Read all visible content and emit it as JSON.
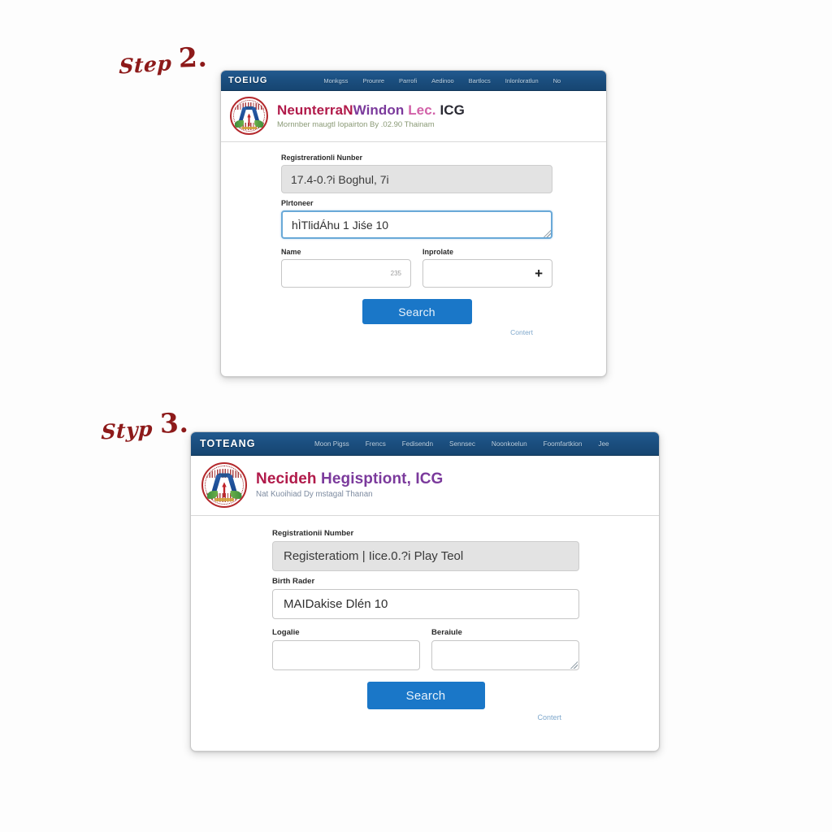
{
  "annotations": {
    "step2": {
      "word": "Step",
      "number": "2."
    },
    "step3": {
      "word": "Styp",
      "number": "3."
    }
  },
  "colors": {
    "navbar": "#1b4f80",
    "search_button": "#1a77c8",
    "readonly_field": "#e3e3e3",
    "focus_border": "#6aa9d8",
    "title_primary": "#b11a4a",
    "title_secondary": "#7b3a9c",
    "helper_link": "#7fa8cc",
    "annotation_ink": "#8d1a1a"
  },
  "window_step2": {
    "navbar": {
      "brand": "TOEIUG",
      "links": [
        "Monkgss",
        "Prounre",
        "Parrofi",
        "Aedinoo",
        "Bartlocs",
        "Inlonloratlun",
        "No"
      ]
    },
    "masthead": {
      "emblem_name": "national-emblem-icon",
      "title_part_1": "NeunterraN",
      "title_part_2": "Windon ",
      "title_part_3": "Lec. ",
      "title_part_4": "ICG",
      "subtitle": "Mornnber maugtl Iopairton By .02.90 Thainam"
    },
    "form": {
      "registration_label": "Registrerationli Nunber",
      "registration_value": "17.4-0.?i Boghul, 7i",
      "pioneer_label": "Plrtoneer",
      "pioneer_value": "hÌTlidÁhu 1 Jiśe 10",
      "name_label": "Name",
      "name_value": "",
      "name_counter": "235",
      "inprolate_label": "Inprolate",
      "inprolate_value": "",
      "inprolate_glyph": "+",
      "search_label": "Search",
      "helper_link_label": "Contert"
    }
  },
  "window_step3": {
    "navbar": {
      "brand": "TOTEANG",
      "links": [
        "Moon Pigss",
        "Frencs",
        "Fedisendn",
        "Sennsec",
        "Noonkoelun",
        "Foomfartkion",
        "Jee"
      ]
    },
    "masthead": {
      "emblem_name": "national-emblem-icon",
      "title_part_1": "Necideh ",
      "title_part_2": "Hegisptiont, ",
      "title_part_3": "",
      "title_part_4": "ICG",
      "subtitle": "Nat Kuoihiad Dy mstagal Thanan"
    },
    "form": {
      "registration_label": "Registrationii Number",
      "registration_value": "Registeratiom | Iice.0.?i Play Teol",
      "birth_label": "Birth Rader",
      "birth_value": "MAIDakise Dlén 10",
      "logalie_label": "Logalie",
      "logalie_value": "",
      "beraiule_label": "Beraiule",
      "beraiule_value": "",
      "search_label": "Search",
      "helper_link_label": "Contert"
    }
  }
}
